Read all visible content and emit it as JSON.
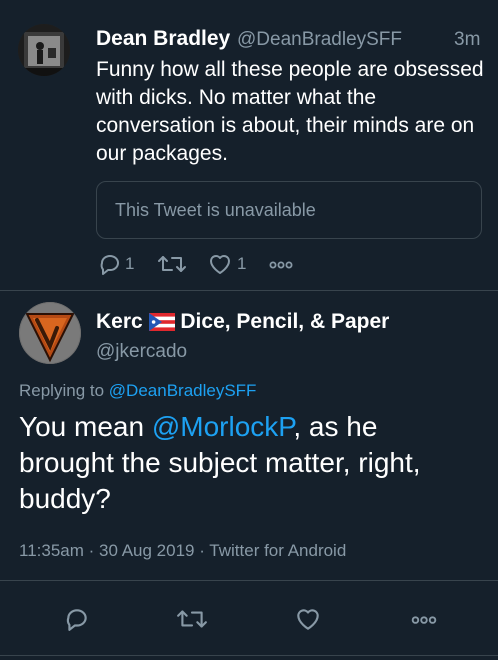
{
  "tweet1": {
    "name": "Dean Bradley",
    "handle": "@DeanBradleySFF",
    "time": "3m",
    "text": "Funny how all these people are obsessed with dicks. No matter what the conversation is about, their minds are on our packages.",
    "quote_text": "This Tweet is unavailable",
    "reply_count": "1",
    "retweet_count": "",
    "like_count": "1"
  },
  "tweet2": {
    "display_name": "Kerc",
    "display_name_rest": "Dice, Pencil, & Paper",
    "handle": "@jkercado",
    "replying_prefix": "Replying to",
    "replying_handle": "@DeanBradleySFF",
    "text_prefix": "You mean ",
    "mention": "@MorlockP",
    "text_suffix": ", as he brought the subject matter, right, buddy?",
    "meta": "11:35am · 30 Aug 2019 · Twitter for Android"
  },
  "colors": {
    "background": "#15202b",
    "muted": "#8899a6",
    "link": "#1da1f2",
    "border": "#38444d"
  }
}
